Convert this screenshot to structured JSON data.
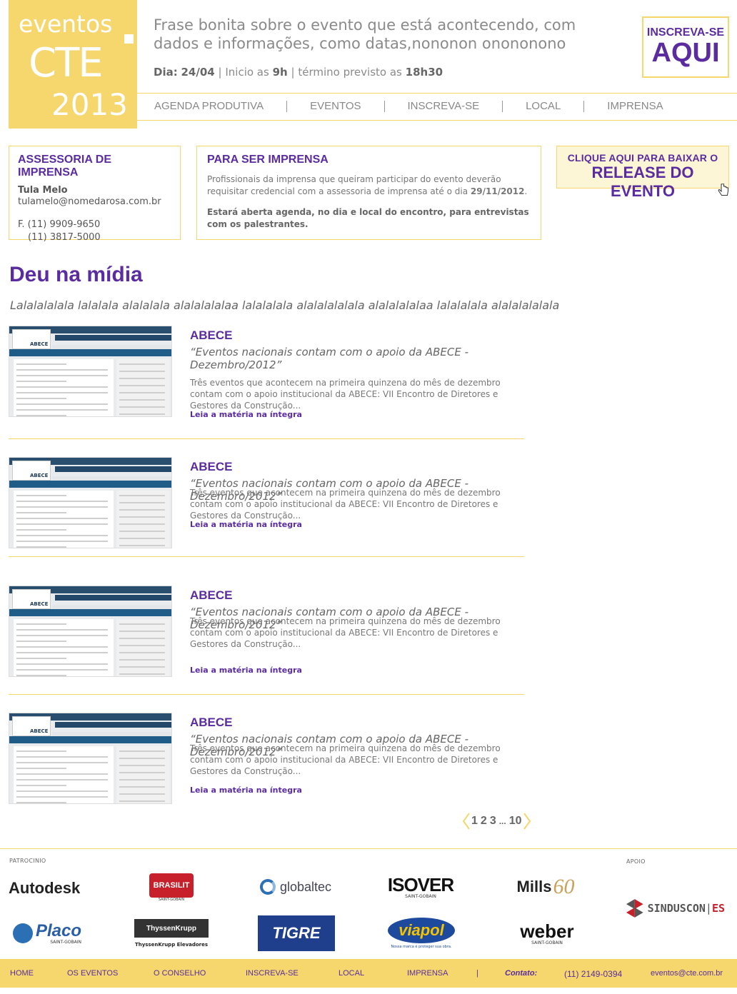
{
  "header": {
    "logo": {
      "line1": "eventos",
      "line2": "CTE",
      "line3": "2013"
    },
    "tagline": "Frase bonita sobre o evento que está acontecendo, com dados e informações, como datas,nononon onononono",
    "date": {
      "label": "Dia:",
      "day": "24/04",
      "start_label": "Inicio as",
      "start": "9h",
      "end_label": "término previsto as",
      "end": "18h30"
    },
    "cta": {
      "line1": "INSCREVA-SE",
      "line2": "AQUI"
    }
  },
  "nav": [
    "AGENDA PRODUTIVA",
    "EVENTOS",
    "INSCREVA-SE",
    "LOCAL",
    "IMPRENSA"
  ],
  "press_office": {
    "title": "ASSESSORIA DE IMPRENSA",
    "name": "Tula Melo",
    "email": "tulamelo@nomedarosa.com.br",
    "phone1": "F. (11) 9909-9650",
    "phone2": "(11) 3817-5000"
  },
  "for_press": {
    "title": "PARA SER IMPRENSA",
    "text1": "Profissionais da imprensa que queiram participar do evento deverão requisitar credencial com a assessoria de imprensa até o dia",
    "date": "29/11/2012",
    "text2": "Estará aberta agenda, no dia e local do encontro, para entrevistas com os palestrantes."
  },
  "release": {
    "line1": "CLIQUE AQUI PARA BAIXAR O",
    "line2": "RELEASE DO EVENTO"
  },
  "media": {
    "title": "Deu na mídia",
    "subtitle": "Lalalalalala lalalala alalalala alalalalalaa lalalalala alalalalalala alalalalalaa lalalalala alalalalalala",
    "articles": [
      {
        "source": "ABECE",
        "quote": "“Eventos nacionais contam com o apoio da ABECE - Dezembro/2012”",
        "text": "Três eventos que acontecem na primeira quinzena do mês de dezembro contam com o apoio institucional da ABECE: VII Encontro de Diretores e Gestores da Construção...",
        "link": "Leia a matéria na íntegra"
      },
      {
        "source": "ABECE",
        "quote": "“Eventos nacionais contam com o apoio da ABECE - Dezembro/2012”",
        "text": "Três eventos que acontecem na primeira quinzena do mês de dezembro contam com o apoio institucional da ABECE: VII Encontro de Diretores e Gestores da Construção...",
        "link": "Leia a matéria na íntegra"
      },
      {
        "source": "ABECE",
        "quote": "“Eventos nacionais contam com o apoio da ABECE - Dezembro/2012”",
        "text": "Três eventos que acontecem na primeira quinzena do mês de dezembro contam com o apoio institucional da ABECE: VII Encontro de Diretores e Gestores da Construção...",
        "link": "Leia a matéria na íntegra"
      },
      {
        "source": "ABECE",
        "quote": "“Eventos nacionais contam com o apoio da ABECE - Dezembro/2012”",
        "text": "Três eventos que acontecem na primeira quinzena do mês de dezembro contam com o apoio institucional da ABECE: VII Encontro de Diretores e Gestores da Construção...",
        "link": "Leia a matéria na íntegra"
      }
    ],
    "thumb_logo": "ABECE"
  },
  "pagination": {
    "pages": [
      "1",
      "2",
      "3"
    ],
    "ellipsis": "...",
    "last": "10"
  },
  "sponsors": {
    "label": "PATROCINIO",
    "support_label": "APOIO",
    "logos": [
      "Autodesk",
      "BRASILIT",
      "globaltec",
      "ISOVER",
      "Mills",
      "Placo",
      "ThyssenKrupp",
      "TIGRE",
      "viapol",
      "weber",
      "SINDUSCON",
      "ES"
    ],
    "captions": {
      "brasilit": "SAINT-GOBAIN",
      "isover": "SAINT-GOBAIN",
      "mills": "60",
      "placo": "SAINT-GOBAIN",
      "thyssen": "ThyssenKrupp Elevadores",
      "viapol": "Nossa marca é proteger sua obra.",
      "weber": "SAINT-GOBAIN"
    }
  },
  "footer": {
    "items": [
      "HOME",
      "OS EVENTOS",
      "O CONSELHO",
      "INSCREVA-SE",
      "LOCAL",
      "IMPRENSA"
    ],
    "contact_label": "Contato:",
    "phone": "(11) 2149-0394",
    "email": "eventos@cte.com.br"
  },
  "colors": {
    "accent": "#f5d76e",
    "brand": "#5a2ca0"
  }
}
